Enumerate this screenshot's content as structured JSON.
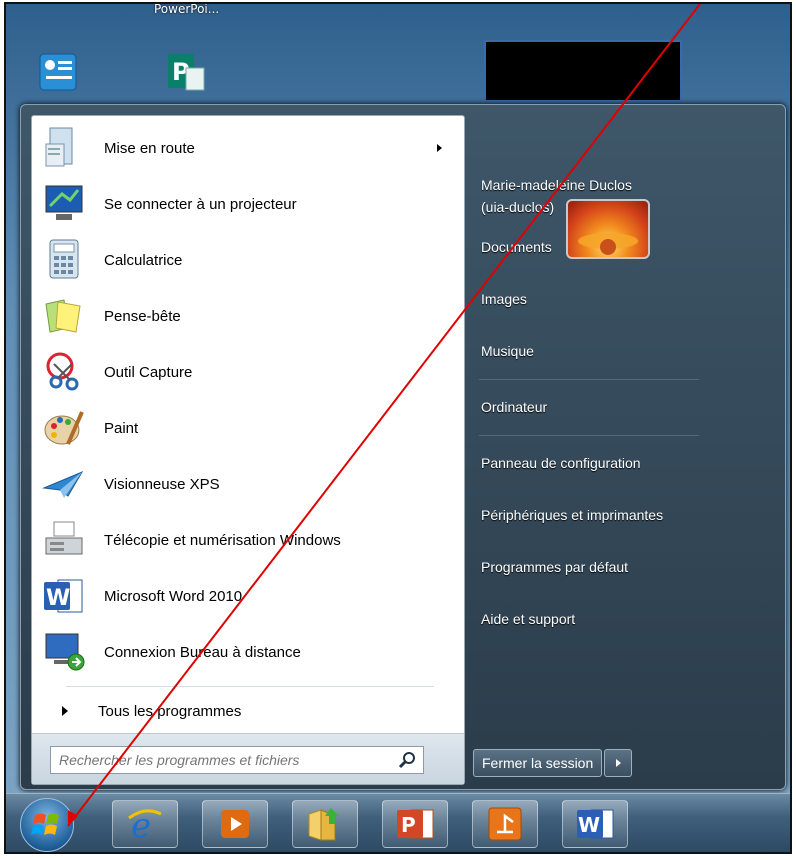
{
  "desktop": {
    "top_label": "PowerPoi..."
  },
  "start_menu": {
    "programs": [
      {
        "label": "Mise en route",
        "icon": "getting-started-icon",
        "submenu": true
      },
      {
        "label": "Se connecter à un projecteur",
        "icon": "projector-icon"
      },
      {
        "label": "Calculatrice",
        "icon": "calculator-icon"
      },
      {
        "label": "Pense-bête",
        "icon": "sticky-notes-icon"
      },
      {
        "label": "Outil Capture",
        "icon": "snipping-tool-icon"
      },
      {
        "label": "Paint",
        "icon": "paint-icon"
      },
      {
        "label": "Visionneuse XPS",
        "icon": "xps-viewer-icon"
      },
      {
        "label": "Télécopie et numérisation Windows",
        "icon": "fax-scan-icon"
      },
      {
        "label": "Microsoft Word 2010",
        "icon": "word-icon"
      },
      {
        "label": "Connexion Bureau à distance",
        "icon": "remote-desktop-icon"
      }
    ],
    "all_programs": "Tous les programmes",
    "search_placeholder": "Rechercher les programmes et fichiers",
    "right": {
      "user_name": "Marie-madeleine Duclos",
      "user_login": "(uia-duclos)",
      "items": [
        "Documents",
        "Images",
        "Musique",
        "Ordinateur",
        "Panneau de configuration",
        "Périphériques et imprimantes",
        "Programmes par défaut",
        "Aide et support"
      ]
    },
    "shutdown_label": "Fermer la session"
  },
  "taskbar": {
    "items": [
      "start-orb",
      "internet-explorer-icon",
      "media-player-icon",
      "file-explorer-icon",
      "powerpoint-icon",
      "presenter-icon",
      "word-icon"
    ]
  },
  "colors": {
    "annotation_line": "#e00000",
    "menu_dark": "#2b3c4a",
    "taskbar": "#3f5f7b"
  }
}
